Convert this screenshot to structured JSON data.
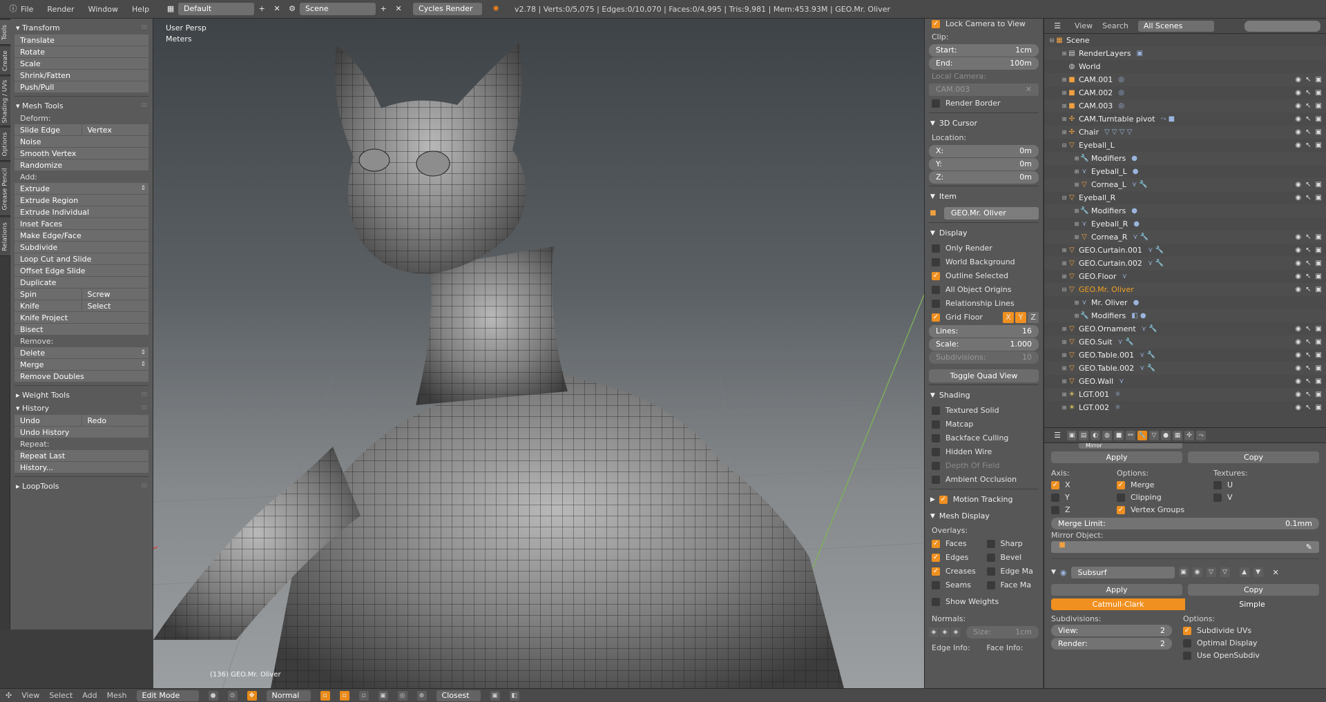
{
  "topbar": {
    "menus": [
      "File",
      "Render",
      "Window",
      "Help"
    ],
    "layout": "Default",
    "scene": "Scene",
    "engine": "Cycles Render",
    "stats": "v2.78 | Verts:0/5,075 | Edges:0/10,070 | Faces:0/4,995 | Tris:9,981 | Mem:453.93M | GEO.Mr. Oliver"
  },
  "tooltabs": [
    "Tools",
    "Create",
    "Shading / UVs",
    "Options",
    "Grease Pencil",
    "Relations"
  ],
  "toolshelf": {
    "transform": {
      "title": "Transform",
      "items": [
        "Translate",
        "Rotate",
        "Scale",
        "Shrink/Fatten",
        "Push/Pull"
      ]
    },
    "meshtools": {
      "title": "Mesh Tools",
      "deform_label": "Deform:",
      "slide_edge": "Slide Edge",
      "vertex": "Vertex",
      "noise": "Noise",
      "smooth_vertex": "Smooth Vertex",
      "randomize": "Randomize",
      "add_label": "Add:",
      "extrude": "Extrude",
      "extrude_region": "Extrude Region",
      "extrude_individual": "Extrude Individual",
      "inset_faces": "Inset Faces",
      "make_edge_face": "Make Edge/Face",
      "subdivide": "Subdivide",
      "loop_cut": "Loop Cut and Slide",
      "offset_edge": "Offset Edge Slide",
      "duplicate": "Duplicate",
      "spin": "Spin",
      "screw": "Screw",
      "knife": "Knife",
      "select": "Select",
      "knife_project": "Knife Project",
      "bisect": "Bisect",
      "remove_label": "Remove:",
      "delete": "Delete",
      "merge": "Merge",
      "remove_doubles": "Remove Doubles"
    },
    "weight_tools": "Weight Tools",
    "history": {
      "title": "History",
      "undo": "Undo",
      "redo": "Redo",
      "undo_history": "Undo History",
      "repeat_label": "Repeat:",
      "repeat_last": "Repeat Last",
      "history_dots": "History..."
    },
    "looptools": "LoopTools"
  },
  "viewport": {
    "view_name": "User Persp",
    "units": "Meters",
    "object_info": "(136) GEO.Mr. Oliver"
  },
  "npanel": {
    "lock_camera": "Lock Camera to View",
    "clip_label": "Clip:",
    "clip_start_label": "Start:",
    "clip_start": "1cm",
    "clip_end_label": "End:",
    "clip_end": "100m",
    "local_camera_label": "Local Camera:",
    "local_camera": "CAM.003",
    "render_border": "Render Border",
    "cursor_title": "3D Cursor",
    "location_label": "Location:",
    "x_label": "X:",
    "x": "0m",
    "y_label": "Y:",
    "y": "0m",
    "z_label": "Z:",
    "z": "0m",
    "item_title": "Item",
    "item_name": "GEO.Mr. Oliver",
    "display_title": "Display",
    "only_render": "Only Render",
    "world_background": "World Background",
    "outline_selected": "Outline Selected",
    "all_origins": "All Object Origins",
    "relationship_lines": "Relationship Lines",
    "grid_floor": "Grid Floor",
    "axis_x": "X",
    "axis_y": "Y",
    "axis_z": "Z",
    "lines_label": "Lines:",
    "lines": "16",
    "scale_label": "Scale:",
    "scale": "1.000",
    "subdiv_label": "Subdivisions:",
    "subdiv": "10",
    "toggle_quad": "Toggle Quad View",
    "shading_title": "Shading",
    "textured_solid": "Textured Solid",
    "matcap": "Matcap",
    "backface": "Backface Culling",
    "hidden_wire": "Hidden Wire",
    "dof": "Depth Of Field",
    "ao": "Ambient Occlusion",
    "motion_tracking": "Motion Tracking",
    "mesh_display_title": "Mesh Display",
    "overlays_label": "Overlays:",
    "faces": "Faces",
    "sharp": "Sharp",
    "edges": "Edges",
    "bevel": "Bevel",
    "creases": "Creases",
    "edge_marks": "Edge Ma",
    "seams": "Seams",
    "face_marks": "Face Ma",
    "show_weights": "Show Weights",
    "normals_label": "Normals:",
    "size_label": "Size:",
    "size": "1cm",
    "edge_info": "Edge Info:",
    "face_info": "Face Info:"
  },
  "outliner": {
    "view": "View",
    "search": "Search",
    "scenes": "All Scenes",
    "rows": [
      {
        "indent": 0,
        "exp": "⊟",
        "icon": "scene",
        "glyph": "▦",
        "label": "Scene",
        "extra": "",
        "vis": false
      },
      {
        "indent": 1,
        "exp": "⊞",
        "icon": "world",
        "glyph": "▤",
        "label": "RenderLayers",
        "extra": "▣",
        "vis": false
      },
      {
        "indent": 1,
        "exp": "",
        "icon": "world",
        "glyph": "◍",
        "label": "World",
        "extra": "",
        "vis": false
      },
      {
        "indent": 1,
        "exp": "⊞",
        "icon": "cam",
        "glyph": "■",
        "label": "CAM.001",
        "extra": "◎",
        "vis": true
      },
      {
        "indent": 1,
        "exp": "⊞",
        "icon": "cam",
        "glyph": "■",
        "label": "CAM.002",
        "extra": "◎",
        "vis": true
      },
      {
        "indent": 1,
        "exp": "⊞",
        "icon": "cam",
        "glyph": "■",
        "label": "CAM.003",
        "extra": "◎",
        "vis": true
      },
      {
        "indent": 1,
        "exp": "⊞",
        "icon": "empty",
        "glyph": "✣",
        "label": "CAM.Turntable pivot",
        "extra": "⤳ ■",
        "vis": true
      },
      {
        "indent": 1,
        "exp": "⊞",
        "icon": "empty",
        "glyph": "✣",
        "label": "Chair",
        "extra": "▽ ▽ ▽ ▽",
        "vis": true
      },
      {
        "indent": 1,
        "exp": "⊟",
        "icon": "mesh",
        "glyph": "▽",
        "label": "Eyeball_L",
        "extra": "",
        "vis": true
      },
      {
        "indent": 2,
        "exp": "⊞",
        "icon": "mod",
        "glyph": "🔧",
        "label": "Modifiers",
        "extra": "●",
        "vis": false
      },
      {
        "indent": 2,
        "exp": "⊞",
        "icon": "mod",
        "glyph": "⋎",
        "label": "Eyeball_L",
        "extra": "●",
        "vis": false
      },
      {
        "indent": 2,
        "exp": "⊞",
        "icon": "mesh",
        "glyph": "▽",
        "label": "Cornea_L",
        "extra": "⋎ 🔧",
        "vis": true
      },
      {
        "indent": 1,
        "exp": "⊟",
        "icon": "mesh",
        "glyph": "▽",
        "label": "Eyeball_R",
        "extra": "",
        "vis": true
      },
      {
        "indent": 2,
        "exp": "⊞",
        "icon": "mod",
        "glyph": "🔧",
        "label": "Modifiers",
        "extra": "●",
        "vis": false
      },
      {
        "indent": 2,
        "exp": "⊞",
        "icon": "mod",
        "glyph": "⋎",
        "label": "Eyeball_R",
        "extra": "●",
        "vis": false
      },
      {
        "indent": 2,
        "exp": "⊞",
        "icon": "mesh",
        "glyph": "▽",
        "label": "Cornea_R",
        "extra": "⋎ 🔧",
        "vis": true
      },
      {
        "indent": 1,
        "exp": "⊞",
        "icon": "mesh",
        "glyph": "▽",
        "label": "GEO.Curtain.001",
        "extra": "⋎ 🔧",
        "vis": true
      },
      {
        "indent": 1,
        "exp": "⊞",
        "icon": "mesh",
        "glyph": "▽",
        "label": "GEO.Curtain.002",
        "extra": "⋎ 🔧",
        "vis": true
      },
      {
        "indent": 1,
        "exp": "⊞",
        "icon": "mesh",
        "glyph": "▽",
        "label": "GEO.Floor",
        "extra": "⋎",
        "vis": true
      },
      {
        "indent": 1,
        "exp": "⊟",
        "icon": "mesh",
        "glyph": "▽",
        "label": "GEO.Mr. Oliver",
        "extra": "",
        "vis": true,
        "active": true
      },
      {
        "indent": 2,
        "exp": "⊞",
        "icon": "mod",
        "glyph": "⋎",
        "label": "Mr. Oliver",
        "extra": "●",
        "vis": false
      },
      {
        "indent": 2,
        "exp": "⊞",
        "icon": "mod",
        "glyph": "🔧",
        "label": "Modifiers",
        "extra": "◧ ●",
        "vis": false
      },
      {
        "indent": 1,
        "exp": "⊞",
        "icon": "mesh",
        "glyph": "▽",
        "label": "GEO.Ornament",
        "extra": "⋎ 🔧",
        "vis": true
      },
      {
        "indent": 1,
        "exp": "⊞",
        "icon": "mesh",
        "glyph": "▽",
        "label": "GEO.Suit",
        "extra": "⋎ 🔧",
        "vis": true
      },
      {
        "indent": 1,
        "exp": "⊞",
        "icon": "mesh",
        "glyph": "▽",
        "label": "GEO.Table.001",
        "extra": "⋎ 🔧",
        "vis": true
      },
      {
        "indent": 1,
        "exp": "⊞",
        "icon": "mesh",
        "glyph": "▽",
        "label": "GEO.Table.002",
        "extra": "⋎ 🔧",
        "vis": true
      },
      {
        "indent": 1,
        "exp": "⊞",
        "icon": "mesh",
        "glyph": "▽",
        "label": "GEO.Wall",
        "extra": "⋎",
        "vis": true
      },
      {
        "indent": 1,
        "exp": "⊞",
        "icon": "lamp",
        "glyph": "☀",
        "label": "LGT.001",
        "extra": "☼",
        "vis": true
      },
      {
        "indent": 1,
        "exp": "⊞",
        "icon": "lamp",
        "glyph": "☀",
        "label": "LGT.002",
        "extra": "☼",
        "vis": true
      }
    ]
  },
  "properties": {
    "mirror_name": "Mirror",
    "apply": "Apply",
    "copy": "Copy",
    "axis_label": "Axis:",
    "options_label": "Options:",
    "textures_label": "Textures:",
    "ax": "X",
    "ay": "Y",
    "az": "Z",
    "merge": "Merge",
    "clipping": "Clipping",
    "vertex_groups": "Vertex Groups",
    "tu": "U",
    "tv": "V",
    "merge_limit_label": "Merge Limit:",
    "merge_limit": "0.1mm",
    "mirror_object_label": "Mirror Object:",
    "subsurf_name": "Subsurf",
    "catmull": "Catmull-Clark",
    "simple": "Simple",
    "subdivisions_label": "Subdivisions:",
    "options2_label": "Options:",
    "view_label": "View:",
    "view": "2",
    "render_label": "Render:",
    "render": "2",
    "subdivide_uvs": "Subdivide UVs",
    "optimal_display": "Optimal Display",
    "use_opensubdiv": "Use OpenSubdiv"
  },
  "bottombar": {
    "view": "View",
    "select": "Select",
    "add": "Add",
    "mesh": "Mesh",
    "mode": "Edit Mode",
    "pivot": "Normal",
    "snap": "Closest"
  },
  "colors": {
    "accent": "#f09020",
    "active_object": "#f0a020"
  }
}
